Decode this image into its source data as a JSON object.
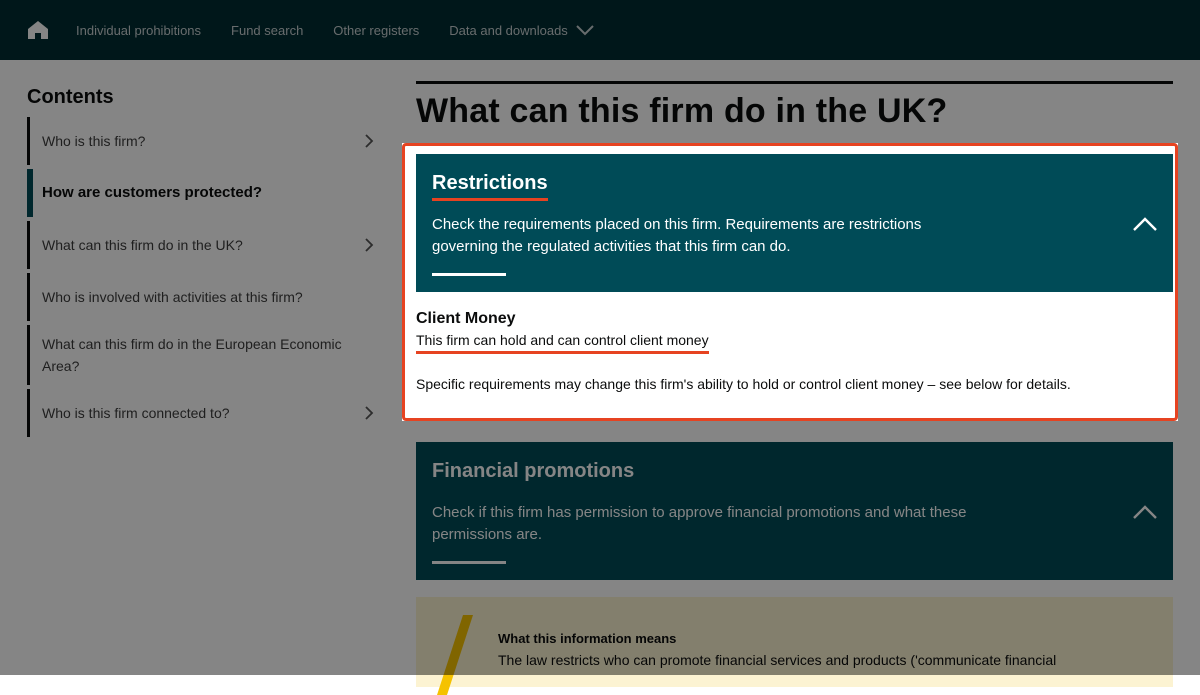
{
  "nav": {
    "items": [
      {
        "label": "Individual prohibitions"
      },
      {
        "label": "Fund search"
      },
      {
        "label": "Other registers"
      },
      {
        "label": "Data and downloads"
      }
    ]
  },
  "sidebar": {
    "title": "Contents",
    "items": [
      {
        "label": "Who is this firm?"
      },
      {
        "label": "How are customers protected?"
      },
      {
        "label": "What can this firm do in the UK?"
      },
      {
        "label": "Who is involved with activities at this firm?"
      },
      {
        "label": "What can this firm do in the European Economic Area?"
      },
      {
        "label": "Who is this firm connected to?"
      }
    ]
  },
  "main": {
    "title": "What can this firm do in the UK?",
    "restrictions": {
      "title": "Restrictions",
      "description": "Check the requirements placed on this firm. Requirements are restrictions governing the regulated activities that this firm can do.",
      "client_money_title": "Client Money",
      "client_money_value": "This firm can hold and can control client money",
      "client_money_note": "Specific requirements may change this firm's ability to hold or control client money – see below for details."
    },
    "financial_promotions": {
      "title": "Financial promotions",
      "description": "Check if this firm has permission to approve financial promotions and what these permissions are."
    },
    "info": {
      "title": "What this information means",
      "text": "The law restricts who can promote financial services and products ('communicate financial"
    }
  },
  "colors": {
    "nav_bg": "#002d33",
    "card_bg": "#004b57",
    "highlight": "#e64321",
    "info_bg": "#fcf3d2",
    "info_accent": "#f5c200"
  }
}
